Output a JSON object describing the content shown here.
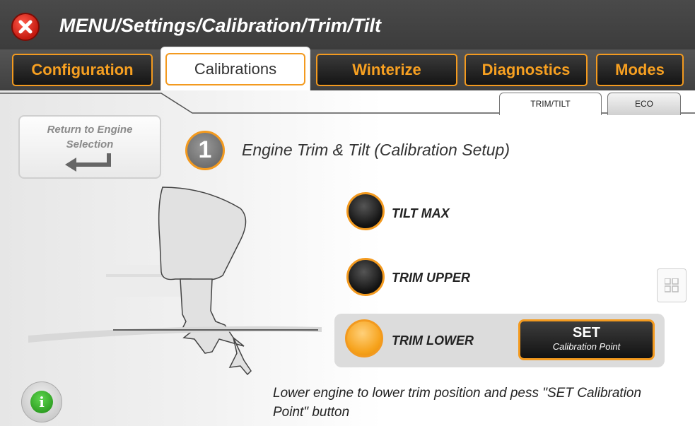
{
  "header": {
    "close_icon": "x-close-icon",
    "title": "MENU/Settings/Calibration/Trim/Tilt"
  },
  "tabs": [
    {
      "label": "Configuration",
      "active": false
    },
    {
      "label": "Calibrations",
      "active": true
    },
    {
      "label": "Winterize",
      "active": false
    },
    {
      "label": "Diagnostics",
      "active": false
    },
    {
      "label": "Modes",
      "active": false
    }
  ],
  "subtabs": [
    {
      "label": "TRIM/TILT",
      "active": true
    },
    {
      "label": "ECO",
      "active": false
    }
  ],
  "return_button": {
    "label_line1": "Return to Engine",
    "label_line2": "Selection",
    "icon": "return-arrow-icon"
  },
  "step": {
    "number": "1",
    "title": "Engine Trim & Tilt (Calibration Setup)"
  },
  "calibration_points": [
    {
      "label": "TILT MAX",
      "state": "off"
    },
    {
      "label": "TRIM UPPER",
      "state": "off"
    },
    {
      "label": "TRIM LOWER",
      "state": "on"
    }
  ],
  "set_button": {
    "label": "SET",
    "sublabel": "Calibration Point"
  },
  "instruction": "Lower engine to lower trim position and pess \"SET Calibration Point\" button",
  "colors": {
    "accent": "#f39a1f",
    "header_bg": "#444444",
    "led_on": "#f6a21b",
    "close": "#d42a1c",
    "info": "#2fae22"
  }
}
